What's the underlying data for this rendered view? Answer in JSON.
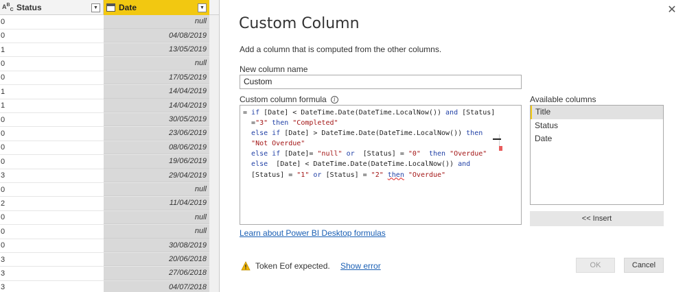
{
  "grid": {
    "columns": [
      {
        "name": "Status",
        "type_icon": "abc-text-type-icon"
      },
      {
        "name": "Date",
        "type_icon": "calendar-date-type-icon"
      }
    ],
    "rows": [
      {
        "status": "0",
        "date": "null"
      },
      {
        "status": "0",
        "date": "04/08/2019"
      },
      {
        "status": "1",
        "date": "13/05/2019"
      },
      {
        "status": "0",
        "date": "null"
      },
      {
        "status": "0",
        "date": "17/05/2019"
      },
      {
        "status": "1",
        "date": "14/04/2019"
      },
      {
        "status": "1",
        "date": "14/04/2019"
      },
      {
        "status": "0",
        "date": "30/05/2019"
      },
      {
        "status": "0",
        "date": "23/06/2019"
      },
      {
        "status": "0",
        "date": "08/06/2019"
      },
      {
        "status": "0",
        "date": "19/06/2019"
      },
      {
        "status": "3",
        "date": "29/04/2019"
      },
      {
        "status": "0",
        "date": "null"
      },
      {
        "status": "2",
        "date": "11/04/2019"
      },
      {
        "status": "0",
        "date": "null"
      },
      {
        "status": "0",
        "date": "null"
      },
      {
        "status": "0",
        "date": "30/08/2019"
      },
      {
        "status": "3",
        "date": "20/06/2018"
      },
      {
        "status": "3",
        "date": "27/06/2018"
      },
      {
        "status": "3",
        "date": "04/07/2018"
      }
    ]
  },
  "dialog": {
    "title": "Custom Column",
    "subtitle": "Add a column that is computed from the other columns.",
    "new_column_label": "New column name",
    "new_column_value": "Custom",
    "formula_label": "Custom column formula",
    "formula_lines": [
      "= if [Date] < DateTime.Date(DateTime.LocalNow()) and [Status]",
      "  =\"3\" then \"Completed\"",
      "  else if [Date] > DateTime.Date(DateTime.LocalNow()) then",
      "  \"Not Overdue\"",
      "  else if [Date]= \"null\" or  [Status] = \"0\"  then \"Overdue\"",
      "  else  [Date] < DateTime.Date(DateTime.LocalNow()) and",
      "  [Status] = \"1\" or [Status] = \"2\" then \"Overdue\""
    ],
    "learn_link": "Learn about Power BI Desktop formulas",
    "available_label": "Available columns",
    "available_columns": [
      "Title",
      "Status",
      "Date"
    ],
    "insert_label": "<< Insert",
    "warning_text": "Token Eof expected.",
    "show_error_label": "Show error",
    "ok_label": "OK",
    "cancel_label": "Cancel"
  },
  "colors": {
    "accent_yellow": "#f2c811",
    "link_blue": "#1a5fb4",
    "keyword_blue": "#1f3fa5",
    "string_red": "#a31515",
    "error_red": "#e85c5c"
  }
}
